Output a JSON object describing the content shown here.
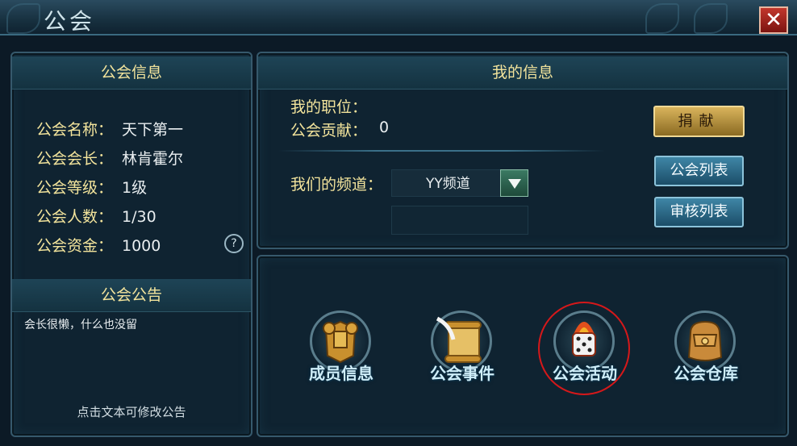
{
  "window": {
    "title": "公会"
  },
  "guild_info": {
    "header": "公会信息",
    "rows": [
      {
        "label": "公会名称：",
        "value": "天下第一"
      },
      {
        "label": "公会会长：",
        "value": "林肯霍尔"
      },
      {
        "label": "公会等级：",
        "value": "1级"
      },
      {
        "label": "公会人数：",
        "value": "1/30"
      },
      {
        "label": "公会资金：",
        "value": "1000"
      }
    ],
    "help_icon": "?"
  },
  "announcement": {
    "header": "公会公告",
    "text": "会长很懒，什么也没留",
    "hint": "点击文本可修改公告"
  },
  "my_info": {
    "header": "我的信息",
    "position_label": "我的职位：",
    "position_value": "",
    "contribution_label": "公会贡献：",
    "contribution_value": "0",
    "channel_label": "我们的频道：",
    "channel_value": "YY频道",
    "channel_input": ""
  },
  "buttons": {
    "donate": "捐献",
    "guild_list": "公会列表",
    "review_list": "审核列表"
  },
  "features": [
    {
      "label": "成员信息",
      "icon": "armor-icon"
    },
    {
      "label": "公会事件",
      "icon": "scroll-quill-icon"
    },
    {
      "label": "公会活动",
      "icon": "dice-fire-icon"
    },
    {
      "label": "公会仓库",
      "icon": "backpack-icon"
    }
  ],
  "colors": {
    "label_gold": "#f3e49c",
    "close_red": "#c2372c",
    "highlight": "#d5181a"
  }
}
